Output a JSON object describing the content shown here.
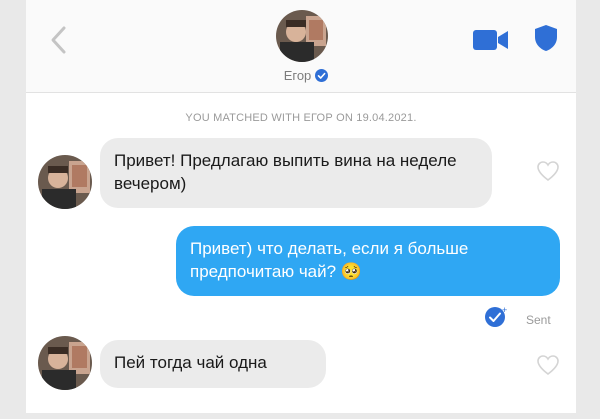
{
  "header": {
    "contact_name": "Егор",
    "back_icon": "chevron-left-icon",
    "video_icon": "video-camera-icon",
    "safety_icon": "shield-icon",
    "verified_icon": "verified-check-icon",
    "accent_color": "#2f6fd6"
  },
  "match_notice": "YOU MATCHED WITH ЕГОР ON 19.04.2021.",
  "messages": [
    {
      "from": "Егор",
      "text": "Привет! Предлагаю выпить вина на неделе вечером)"
    },
    {
      "from": "me",
      "text": "Привет) что делать, если я больше предпочитаю чай? 🥺"
    },
    {
      "from": "Егор",
      "text": "Пей тогда чай одна"
    }
  ],
  "status": {
    "label": "Sent",
    "icon": "sent-check-icon"
  },
  "colors": {
    "incoming_bubble": "#ebebeb",
    "outgoing_bubble": "#2fa7f3"
  }
}
